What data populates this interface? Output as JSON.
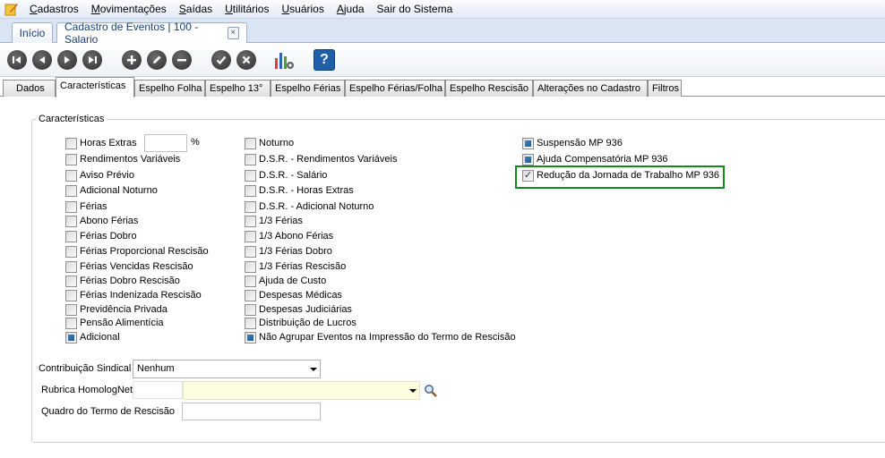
{
  "menu": {
    "items": [
      "Cadastros",
      "Movimentações",
      "Saídas",
      "Utilitários",
      "Usuários",
      "Ajuda",
      "Sair do Sistema"
    ],
    "underline": [
      "C",
      "M",
      "S",
      "U",
      "U",
      "A",
      ""
    ]
  },
  "doc_tabs": {
    "home": "Início",
    "active": "Cadastro de Eventos | 100 - Salario",
    "close_icon": "×"
  },
  "toolbar": {
    "icons": [
      "first-record-icon",
      "previous-record-icon",
      "next-record-icon",
      "last-record-icon",
      "add-icon",
      "edit-icon",
      "remove-icon",
      "confirm-icon",
      "cancel-icon",
      "chart-settings-icon",
      "help-icon"
    ],
    "help_label": "?"
  },
  "content_tabs": [
    "Dados",
    "Características",
    "Espelho Folha",
    "Espelho 13°",
    "Espelho Férias",
    "Espelho Férias/Folha",
    "Espelho Rescisão",
    "Alterações no Cadastro",
    "Filtros"
  ],
  "active_content_tab": "Características",
  "group": {
    "legend": "Características",
    "percent_symbol": "%",
    "col1": [
      {
        "label": "Horas Extras",
        "state": "unchecked"
      },
      {
        "label": "Rendimentos Variáveis",
        "state": "unchecked"
      },
      {
        "label": "Aviso Prévio",
        "state": "unchecked"
      },
      {
        "label": "Adicional Noturno",
        "state": "unchecked"
      },
      {
        "label": "Férias",
        "state": "unchecked"
      },
      {
        "label": "Abono Férias",
        "state": "unchecked"
      },
      {
        "label": "Férias Dobro",
        "state": "unchecked"
      },
      {
        "label": "Férias Proporcional Rescisão",
        "state": "unchecked"
      },
      {
        "label": "Férias Vencidas Rescisão",
        "state": "unchecked"
      },
      {
        "label": "Férias Dobro Rescisão",
        "state": "unchecked"
      },
      {
        "label": "Férias Indenizada Rescisão",
        "state": "unchecked"
      },
      {
        "label": "Previdência Privada",
        "state": "unchecked"
      },
      {
        "label": "Pensão Alimentícia",
        "state": "unchecked"
      },
      {
        "label": "Adicional",
        "state": "indeterminate"
      }
    ],
    "col2": [
      {
        "label": "Noturno",
        "state": "unchecked"
      },
      {
        "label": "D.S.R. - Rendimentos Variáveis",
        "state": "unchecked"
      },
      {
        "label": "D.S.R. - Salário",
        "state": "unchecked"
      },
      {
        "label": "D.S.R. - Horas Extras",
        "state": "unchecked"
      },
      {
        "label": "D.S.R. - Adicional Noturno",
        "state": "unchecked"
      },
      {
        "label": "1/3 Férias",
        "state": "unchecked"
      },
      {
        "label": "1/3 Abono Férias",
        "state": "unchecked"
      },
      {
        "label": "1/3 Férias Dobro",
        "state": "unchecked"
      },
      {
        "label": "1/3 Férias Rescisão",
        "state": "unchecked"
      },
      {
        "label": "Ajuda de Custo",
        "state": "unchecked"
      },
      {
        "label": "Despesas Médicas",
        "state": "unchecked"
      },
      {
        "label": "Despesas Judiciárias",
        "state": "unchecked"
      },
      {
        "label": "Distribuição de Lucros",
        "state": "unchecked"
      },
      {
        "label": "Não Agrupar Eventos na Impressão do Termo de Rescisão",
        "state": "indeterminate"
      }
    ],
    "col3": [
      {
        "label": "Suspensão MP 936",
        "state": "indeterminate"
      },
      {
        "label": "Ajuda Compensatória MP 936",
        "state": "indeterminate"
      },
      {
        "label": "Redução da Jornada de Trabalho MP 936",
        "state": "checked"
      }
    ]
  },
  "form": {
    "contribuicao_label": "Contribuição Sindical",
    "contribuicao_value": "Nenhum",
    "rubrica_label": "Rubrica HomologNet",
    "rubrica_code": "",
    "rubrica_value": "",
    "quadro_label": "Quadro do Termo de Rescisão",
    "quadro_value": ""
  },
  "colors": {
    "highlight_border": "#138a1c",
    "checkbox_fill": "#1f5e94",
    "rubrica_field_bg": "#fdfde0"
  }
}
